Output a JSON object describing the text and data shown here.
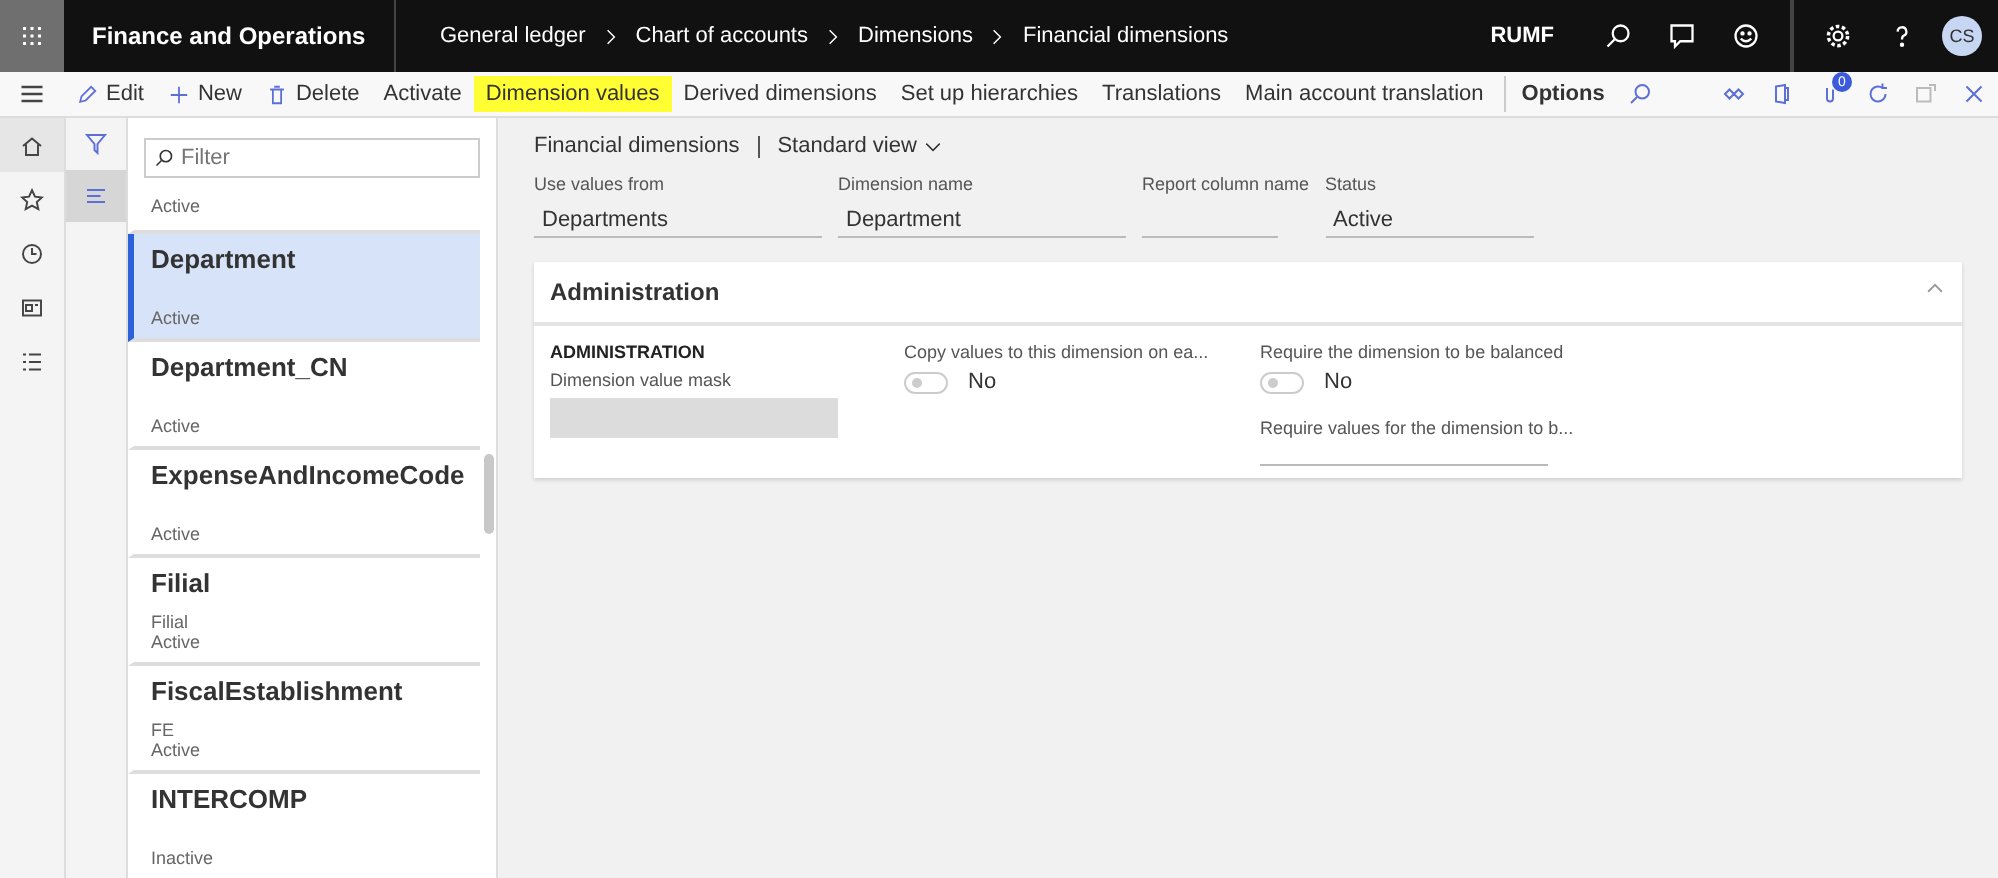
{
  "top_bar": {
    "app_title": "Finance and Operations",
    "breadcrumbs": [
      "General ledger",
      "Chart of accounts",
      "Dimensions",
      "Financial dimensions"
    ],
    "company": "RUMF",
    "avatar": "CS"
  },
  "action_pane": {
    "actions": [
      {
        "label": "Edit",
        "kind": "edit",
        "highlighted": false
      },
      {
        "label": "New",
        "kind": "new",
        "highlighted": false
      },
      {
        "label": "Delete",
        "kind": "delete",
        "highlighted": false
      },
      {
        "label": "Activate",
        "kind": "text",
        "highlighted": false
      },
      {
        "label": "Dimension values",
        "kind": "text",
        "highlighted": true
      },
      {
        "label": "Derived dimensions",
        "kind": "text",
        "highlighted": false
      },
      {
        "label": "Set up hierarchies",
        "kind": "text",
        "highlighted": false
      },
      {
        "label": "Translations",
        "kind": "text",
        "highlighted": false
      },
      {
        "label": "Main account translation",
        "kind": "text",
        "highlighted": false
      }
    ],
    "options": "Options",
    "notification_count": "0"
  },
  "list": {
    "filter_placeholder": "Filter",
    "items": [
      {
        "status": "Active",
        "selected": false
      },
      {
        "title": "Department",
        "status": "Active",
        "selected": true
      },
      {
        "title": "Department_CN",
        "status": "Active",
        "selected": false
      },
      {
        "title": "ExpenseAndIncomeCode",
        "status": "Active",
        "selected": false
      },
      {
        "title": "Filial",
        "subtitle": "Filial",
        "status": "Active",
        "selected": false
      },
      {
        "title": "FiscalEstablishment",
        "subtitle": "FE",
        "status": "Active",
        "selected": false
      },
      {
        "title": "INTERCOMP",
        "status": "Inactive",
        "selected": false
      }
    ]
  },
  "details": {
    "form_title": "Financial dimensions",
    "view": "Standard view",
    "fields": [
      {
        "label": "Use values from",
        "value": "Departments"
      },
      {
        "label": "Dimension name",
        "value": "Department"
      },
      {
        "label": "Report column name"
      },
      {
        "label": "Status",
        "value": "Active"
      }
    ],
    "section": {
      "title": "Administration",
      "expanded": true,
      "group_label": "ADMINISTRATION",
      "mask_label": "Dimension value mask",
      "toggles": [
        {
          "label": "Copy values to this dimension on ea...",
          "on": false,
          "value": "No"
        },
        {
          "label": "Require the dimension to be balanced",
          "on": false,
          "value": "No"
        }
      ],
      "required_label": "Require values for the dimension to b..."
    }
  }
}
